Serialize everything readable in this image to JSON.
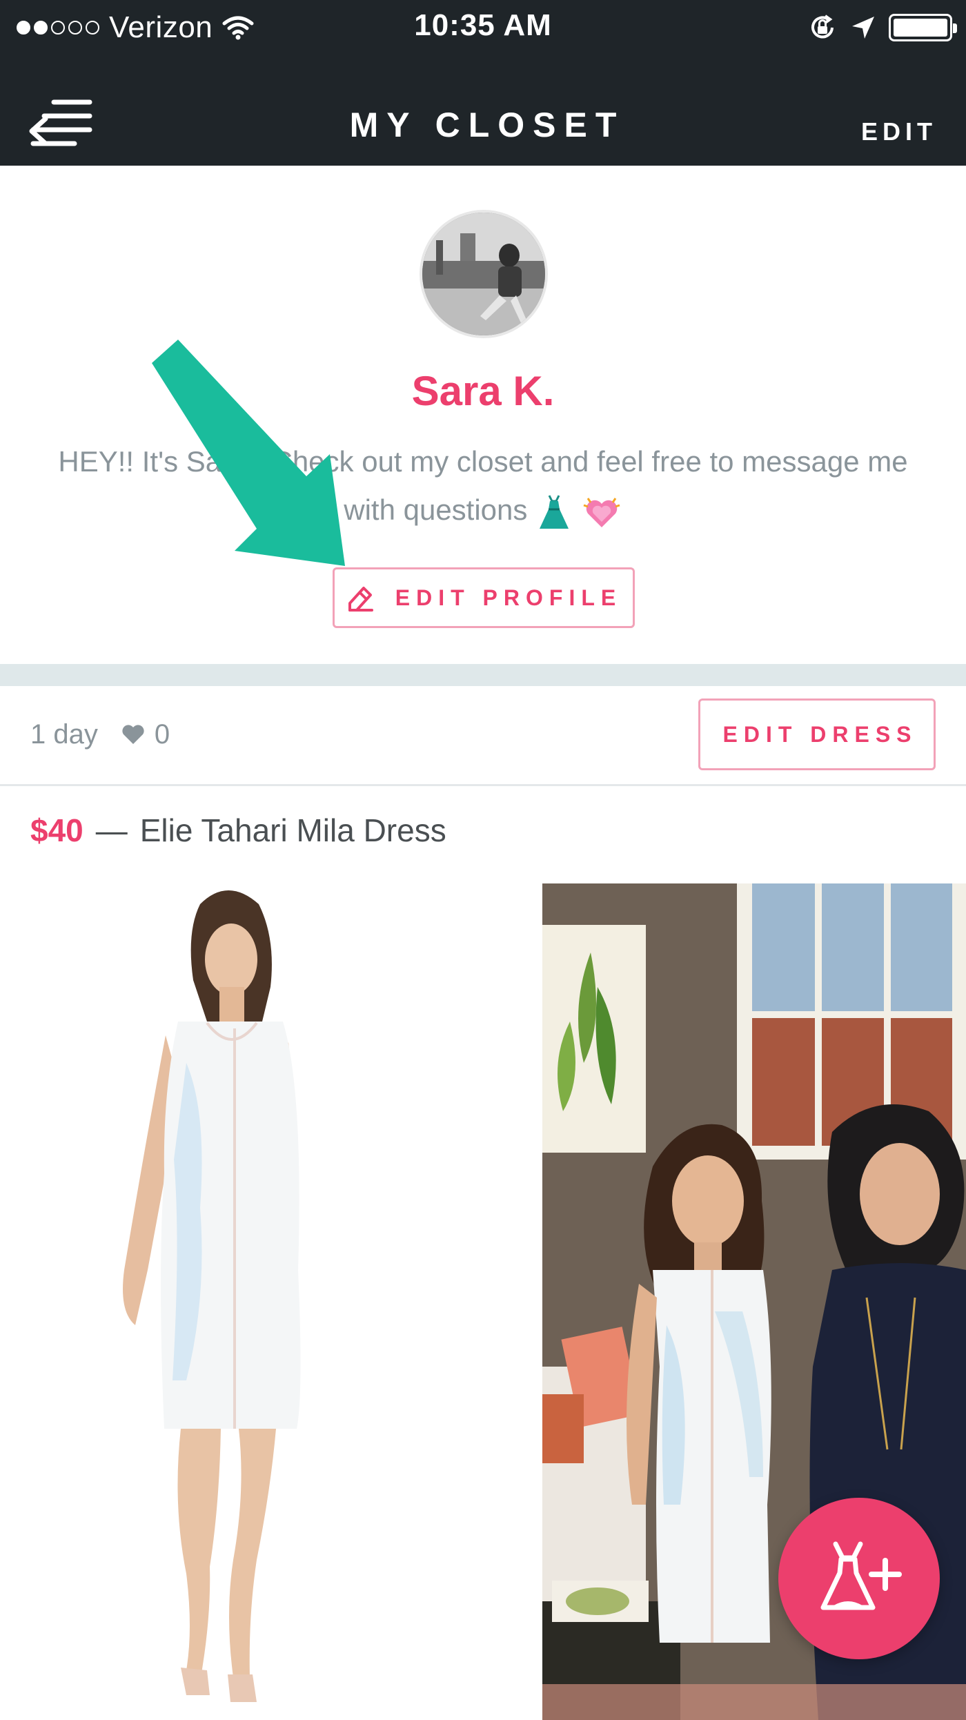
{
  "status_bar": {
    "carrier": "Verizon",
    "time": "10:35 AM",
    "signal_bars_filled": 2,
    "signal_bars_total": 5,
    "battery_level": 1.0
  },
  "nav": {
    "title": "MY CLOSET",
    "edit_label": "EDIT",
    "back_icon": "menu-back-icon"
  },
  "profile": {
    "name": "Sara K.",
    "bio_line1": "HEY!! It's Sara!! Check out my closet and feel free to message me",
    "bio_line2": "with questions",
    "edit_profile_label": "EDIT PROFILE"
  },
  "item": {
    "age": "1 day",
    "likes": "0",
    "edit_dress_label": "EDIT DRESS",
    "price": "$40",
    "separator": "—",
    "name": "Elie Tahari Mila Dress"
  },
  "fab": {
    "icon": "add-dress-icon"
  },
  "colors": {
    "header_bg": "#1f2529",
    "accent_pink": "#ec3f6d",
    "annotation_teal": "#1abc9c"
  }
}
